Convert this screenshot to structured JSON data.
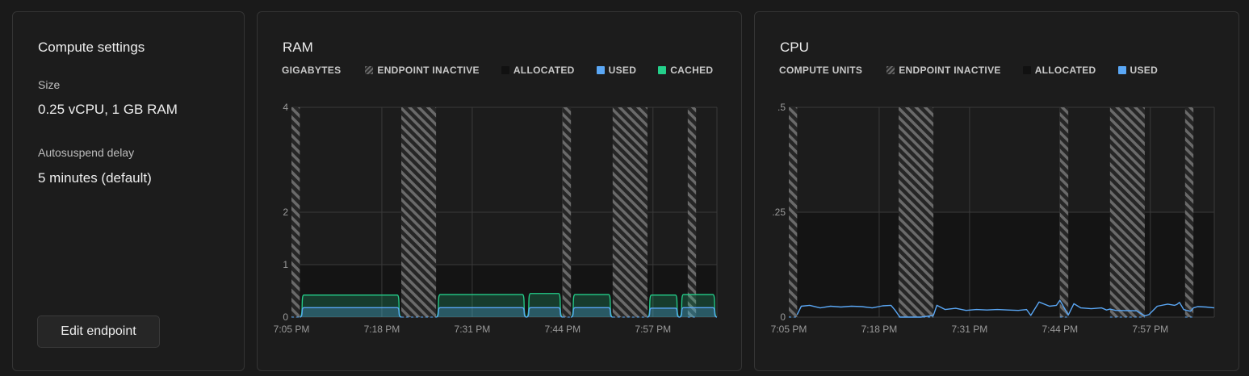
{
  "settings": {
    "title": "Compute settings",
    "size_label": "Size",
    "size_value": "0.25 vCPU, 1 GB RAM",
    "autosuspend_label": "Autosuspend delay",
    "autosuspend_value": "5 minutes (default)",
    "edit_button": "Edit endpoint"
  },
  "ram": {
    "title": "RAM",
    "unit": "GIGABYTES",
    "legend": [
      {
        "key": "hatch",
        "label": "ENDPOINT INACTIVE"
      },
      {
        "key": "alloc",
        "label": "ALLOCATED"
      },
      {
        "key": "used",
        "label": "USED"
      },
      {
        "key": "cached",
        "label": "CACHED"
      }
    ]
  },
  "cpu": {
    "title": "CPU",
    "unit": "COMPUTE UNITS",
    "legend": [
      {
        "key": "hatch",
        "label": "ENDPOINT INACTIVE"
      },
      {
        "key": "alloc",
        "label": "ALLOCATED"
      },
      {
        "key": "used",
        "label": "USED"
      }
    ]
  },
  "colors": {
    "used": "#5aa7f5",
    "cached": "#24cf8a",
    "allocated": "#111111",
    "inactive": "#6a6a6a"
  },
  "chart_data": [
    {
      "type": "area",
      "title": "RAM",
      "ylabel": "GIGABYTES",
      "ylim": [
        0,
        4
      ],
      "yticks": [
        "0",
        "1",
        "2",
        "4"
      ],
      "xticks": [
        "7:05 PM",
        "7:18 PM",
        "7:31 PM",
        "7:44 PM",
        "7:57 PM"
      ],
      "x_minutes": [
        0,
        13,
        26,
        39,
        52
      ],
      "inactive": [
        [
          0,
          1.2
        ],
        [
          15.8,
          20.8
        ],
        [
          39,
          40.2
        ],
        [
          46.2,
          51.2
        ],
        [
          57,
          58.2
        ]
      ],
      "segments": [
        {
          "x": [
            1.2,
            15.8
          ],
          "allocated": 1,
          "cached": 0.42,
          "used": 0.18
        },
        {
          "x": [
            20.8,
            33.8
          ],
          "allocated": 1,
          "cached": 0.43,
          "used": 0.18
        },
        {
          "x": [
            33.8,
            39
          ],
          "allocated": 1,
          "cached": 0.45,
          "used": 0.18
        },
        {
          "x": [
            40.2,
            46.2
          ],
          "allocated": 1,
          "cached": 0.43,
          "used": 0.18
        },
        {
          "x": [
            51.2,
            55.8
          ],
          "allocated": 1,
          "cached": 0.42,
          "used": 0.17
        },
        {
          "x": [
            55.8,
            61.2
          ],
          "allocated": 1,
          "cached": 0.43,
          "used": 0.18
        }
      ],
      "series": [
        {
          "name": "CACHED"
        },
        {
          "name": "USED"
        }
      ]
    },
    {
      "type": "line",
      "title": "CPU",
      "ylabel": "COMPUTE UNITS",
      "ylim": [
        0,
        0.5
      ],
      "yticks": [
        "0",
        ".25",
        ".5"
      ],
      "xticks": [
        "7:05 PM",
        "7:18 PM",
        "7:31 PM",
        "7:44 PM",
        "7:57 PM"
      ],
      "x_minutes": [
        0,
        13,
        26,
        39,
        52
      ],
      "inactive": [
        [
          0,
          1.2
        ],
        [
          15.8,
          20.8
        ],
        [
          39,
          40.2
        ],
        [
          46.2,
          51.2
        ],
        [
          57,
          58.2
        ]
      ],
      "allocated": 0.25,
      "series": [
        {
          "name": "USED",
          "x": [
            1.2,
            1.8,
            3,
            4.5,
            6,
            7.5,
            9,
            10.5,
            12,
            13.5,
            14.7,
            15.3,
            15.8,
            16,
            19,
            20.8,
            21.3,
            22.5,
            24,
            25.5,
            27,
            28.5,
            30,
            31.5,
            33,
            34.2,
            34.8,
            36,
            37.5,
            38.5,
            39,
            40.2,
            41,
            42,
            43.5,
            45,
            45.7,
            46.2,
            47,
            50,
            51.2,
            51.8,
            53,
            54.5,
            55.5,
            55.8,
            56.2,
            56.8,
            57.2,
            57.8,
            58.2,
            58.8,
            60,
            61.2
          ],
          "y": [
            0.006,
            0.026,
            0.028,
            0.022,
            0.026,
            0.024,
            0.026,
            0.025,
            0.022,
            0.027,
            0.028,
            0.016,
            0.004,
            0,
            0,
            0.004,
            0.028,
            0.018,
            0.021,
            0.016,
            0.018,
            0.017,
            0.018,
            0.017,
            0.016,
            0.018,
            0.004,
            0.036,
            0.026,
            0.028,
            0.04,
            0.005,
            0.032,
            0.022,
            0.02,
            0.022,
            0.017,
            0.019,
            0.016,
            0.015,
            0.003,
            0.006,
            0.026,
            0.031,
            0.028,
            0.03,
            0.035,
            0.018,
            0.016,
            0.014,
            0.022,
            0.025,
            0.024,
            0.022
          ]
        }
      ]
    }
  ]
}
